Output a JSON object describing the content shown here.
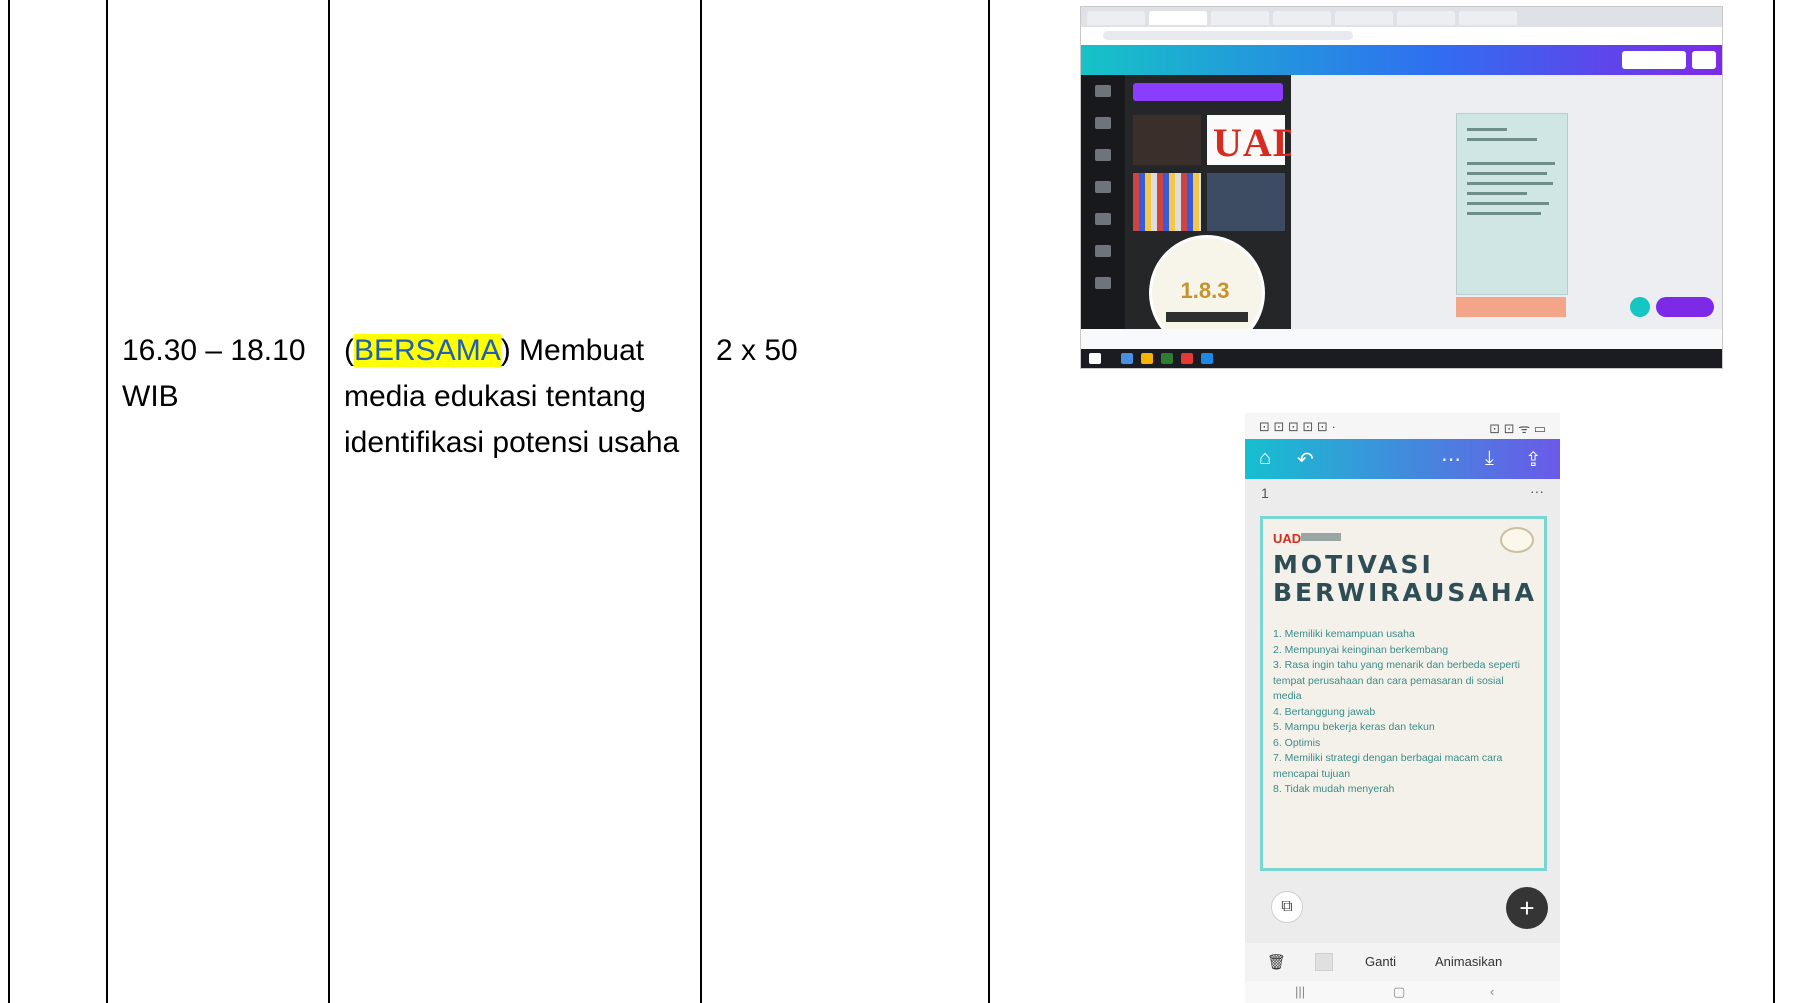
{
  "row": {
    "time": "16.30 – 18.10 WIB",
    "activity_highlight": "BERSAMA",
    "activity_rest": " Membuat media edukasi tentang identifikasi potensi usaha",
    "activity_open": "(",
    "activity_close": ")",
    "duration": "2 x 50"
  },
  "desktop_screenshot": {
    "brand_text": "UAD",
    "badge_number": "1.8.3"
  },
  "phone_screenshot": {
    "status_left": "⊡ ⊡ ⊡ ⊡ ⊡ ·",
    "status_right": "⊡ ⊡ ᯤ ▭",
    "page_indicator": "1",
    "more_label": "···",
    "logo_text": "UAD",
    "title": "MOTIVASI BERWIRAUSAHA",
    "list_items": [
      "1. Memiliki kemampuan usaha",
      "2. Mempunyai keinginan berkembang",
      "3. Rasa ingin tahu yang menarik dan berbeda seperti tempat perusahaan dan cara pemasaran di sosial media",
      "4. Bertanggung jawab",
      "5. Mampu bekerja keras dan tekun",
      "6. Optimis",
      "7. Memiliki strategi dengan berbagai macam cara mencapai tujuan",
      "8. Tidak mudah menyerah"
    ],
    "add_label": "+",
    "pages_label": "⧉",
    "ganti_label": "Ganti",
    "animate_label": "Animasikan",
    "colors": {
      "header_start": "#16bfd0",
      "header_end": "#6a5ae8",
      "card_border": "#78d7d3"
    }
  }
}
